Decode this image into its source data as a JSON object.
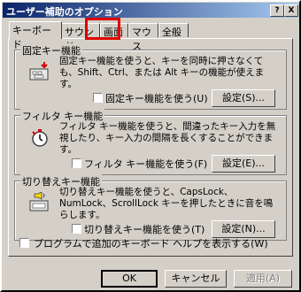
{
  "window": {
    "title": "ユーザー補助のオプション",
    "help_btn": "?",
    "close_btn": "X"
  },
  "tabs": [
    {
      "label": "キーボード",
      "active": true
    },
    {
      "label": "サウンド",
      "active": false
    },
    {
      "label": "画面",
      "active": false,
      "highlighted": true
    },
    {
      "label": "マウス",
      "active": false
    },
    {
      "label": "全般",
      "active": false
    }
  ],
  "groups": {
    "sticky": {
      "title": "固定キー機能",
      "desc": "固定キー機能を使うと、キーを同時に押さなくても、Shift、Ctrl、または Alt キーの機能が使えます。",
      "check_label": "固定キー機能を使う(U)",
      "settings_label": "設定(S)..."
    },
    "filter": {
      "title": "フィルタ キー機能",
      "desc": "フィルタ キー機能を使うと、間違ったキー入力を無視したり、キー入力の間隔を長くすることができます。",
      "check_label": "フィルタ キー機能を使う(F)",
      "settings_label": "設定(E)..."
    },
    "toggle": {
      "title": "切り替えキー機能",
      "desc": "切り替えキー機能を使うと、CapsLock、NumLock、ScrollLock キーを押したときに音を鳴らします。",
      "check_label": "切り替えキー機能を使う(T)",
      "settings_label": "設定(N)..."
    }
  },
  "extra_check_label": "プログラムで追加のキーボード ヘルプを表示する(W)",
  "buttons": {
    "ok": "OK",
    "cancel": "キャンセル",
    "apply": "適用(A)"
  }
}
